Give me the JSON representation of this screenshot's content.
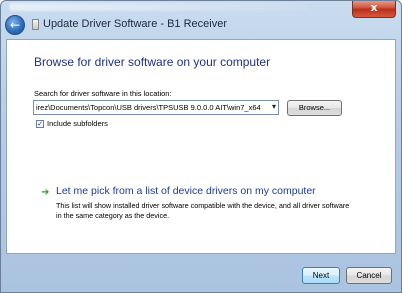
{
  "window": {
    "title": "Update Driver Software - B1 Receiver",
    "close_label": "x",
    "back_glyph": "←"
  },
  "main": {
    "heading": "Browse for driver software on your computer",
    "search_label": "Search for driver software in this location:",
    "path_value": "irez\\Documents\\Topcon\\USB drivers\\TPSUSB 9.0.0.0 AIT\\win7_x64",
    "combo_arrow": "▾",
    "browse_label": "Browse...",
    "include_subfolders_checked": true,
    "check_mark": "✓",
    "include_subfolders_label": "Include subfolders",
    "pick_icon": "➔",
    "pick_link": "Let me pick from a list of device drivers on my computer",
    "pick_description": "This list will show installed driver software compatible with the device, and all driver software in the same category as the device."
  },
  "footer": {
    "next_label": "Next",
    "cancel_label": "Cancel"
  },
  "colors": {
    "heading": "#1e3287",
    "link": "#1a3d9a",
    "arrow": "#2e9c2e",
    "close": "#c8402a"
  }
}
